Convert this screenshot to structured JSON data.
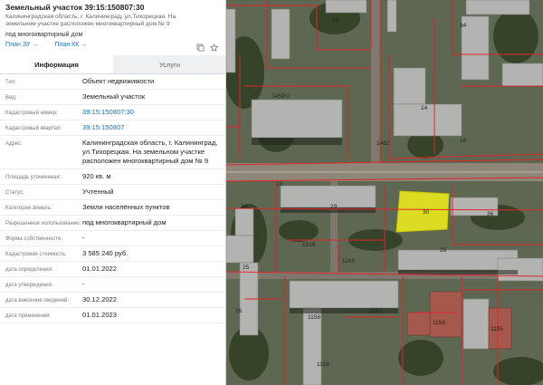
{
  "header": {
    "title": "Земельный участок 39:15:150807:30",
    "address": "Калининградская область, г. Калининград, ул.Тихорецкая. На земельном участке расположен многоквартирный дом № 9",
    "usage": "под многоквартирный дом",
    "links": [
      "План ЗУ →",
      "План КК →"
    ],
    "icons": [
      "copy-icon",
      "star-icon"
    ]
  },
  "tabs": [
    {
      "label": "Информация",
      "active": true
    },
    {
      "label": "Услуги",
      "active": false
    }
  ],
  "properties": [
    {
      "key": "Тип:",
      "value": "Объект недвижимости",
      "link": false
    },
    {
      "key": "Вид:",
      "value": "Земельный участок",
      "link": false
    },
    {
      "key": "Кадастровый номер:",
      "value": "39:15:150807:30",
      "link": true
    },
    {
      "key": "Кадастровый квартал:",
      "value": "39:15:150807",
      "link": true
    },
    {
      "key": "Адрес:",
      "value": "Калининградская область, г. Калининград, ул.Тихорецкая. На земельном участке расположен многоквартирный дом № 9",
      "link": false
    },
    {
      "key": "Площадь уточненная:",
      "value": "920 кв. м",
      "link": false
    },
    {
      "key": "Статус:",
      "value": "Учтенный",
      "link": false
    },
    {
      "key": "Категория земель:",
      "value": "Земли населённых пунктов",
      "link": false
    },
    {
      "key": "Разрешенное использование:",
      "value": "под многоквартирный дом",
      "link": false
    },
    {
      "key": "Форма собственности:",
      "value": "-",
      "link": false
    },
    {
      "key": "Кадастровая стоимость:",
      "value": "3 585 240 руб.",
      "link": false
    },
    {
      "key": "дата определения:",
      "value": "01.01.2022",
      "link": false
    },
    {
      "key": "дата утверждения:",
      "value": "-",
      "link": false
    },
    {
      "key": "дата внесения сведений:",
      "value": "30.12.2022",
      "link": false
    },
    {
      "key": "дата применения:",
      "value": "01.01.2023",
      "link": false
    }
  ],
  "map": {
    "parcel_labels": [
      "19",
      "34",
      "1459/1",
      "14",
      "16",
      "1462",
      "29",
      "30",
      "36",
      "34",
      "1519",
      "1163",
      "28",
      "1158",
      "1157",
      "1156",
      "1155",
      "1159",
      "25",
      "26",
      "23"
    ],
    "highlight_color": "#f2f21a",
    "boundary_color": "#e0252b"
  }
}
